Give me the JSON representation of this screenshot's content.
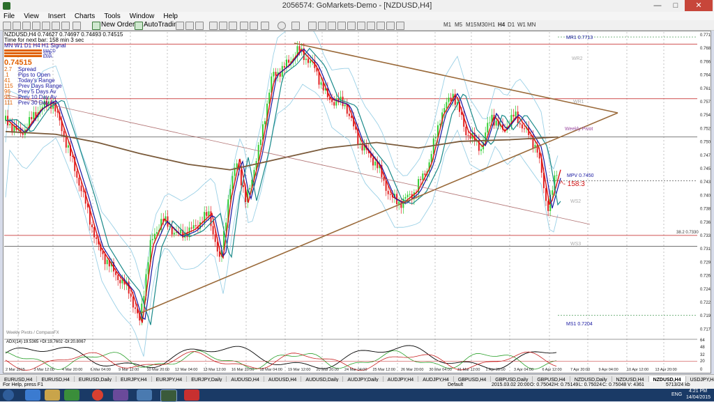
{
  "window": {
    "title": "2056574: GoMarkets-Demo - [NZDUSD,H4]",
    "minimize": "—",
    "maximize": "□",
    "close": "✕"
  },
  "menu": [
    "File",
    "View",
    "Insert",
    "Charts",
    "Tools",
    "Window",
    "Help"
  ],
  "toolbar": {
    "new_order": "New Order",
    "autotrading": "AutoTrading",
    "timeframes": [
      "M1",
      "M5",
      "M15",
      "M30",
      "H1",
      "H4",
      "D1",
      "W1",
      "MN"
    ]
  },
  "chart": {
    "symbol_line": "NZDUSD,H4 0.74627 0.74697 0.74493 0.74515",
    "timer_line": "Time for next bar: 158 min 3 sec",
    "signal_header": "MN W1 D1 H4 H1 Signal",
    "bars_legend": [
      "MACD",
      "STR",
      "EMA"
    ],
    "price": "0.74515",
    "stats": [
      {
        "value": "2.7",
        "label": "Spread"
      },
      {
        "value": ".1",
        "label": "Pips to Open"
      },
      {
        "value": "41",
        "label": "Today's Range"
      },
      {
        "value": "115",
        "label": "Prev Days Range"
      },
      {
        "value": "96",
        "label": "Prev 5 Days Av"
      },
      {
        "value": "95",
        "label": "Prev 10 Day Av"
      },
      {
        "value": "111",
        "label": "Prev 30 Day Av"
      }
    ],
    "pivots": {
      "mr1": "MR1  0.7713",
      "wr2_top": "WR2",
      "wr1": "WR1",
      "wp": "Weekly Pivot",
      "mpv": "MPV  0.7450",
      "pips": "^- 158:3",
      "ws2": "WS2",
      "fib": "38.2  0.7330",
      "ws3": "WS3",
      "ms1": "MS1  0.7204",
      "footer": "Weekly Pivots / CompassFX"
    },
    "price_ticks": [
      "0.77130",
      "0.76895",
      "0.76665",
      "0.76430",
      "0.76195",
      "0.75730",
      "0.75495",
      "0.75230",
      "0.75030",
      "0.74795",
      "0.74515",
      "0.74325",
      "0.74095",
      "0.73860",
      "0.73625",
      "0.73390",
      "0.73160",
      "0.72925",
      "0.72690",
      "0.72460",
      "0.72225",
      "0.71990",
      "0.71755"
    ],
    "time_ticks": [
      "2 Mar 2015",
      "3 Mar 12:00",
      "4 Mar 20:00",
      "6 Mar 04:00",
      "9 Mar 12:00",
      "10 Mar 20:00",
      "12 Mar 04:00",
      "13 Mar 12:00",
      "16 Mar 20:00",
      "18 Mar 04:00",
      "19 Mar 12:00",
      "20 Mar 20:00",
      "24 Mar 04:00",
      "25 Mar 12:00",
      "26 Mar 20:00",
      "30 Mar 04:00",
      "31 Mar 12:00",
      "1 Apr 20:00",
      "3 Apr 04:00",
      "6 Apr 12:00",
      "7 Apr 20:00",
      "9 Apr 04:00",
      "10 Apr 12:00",
      "13 Apr 20:00"
    ],
    "adx_label": "ADX(14) 19.5365 +DI:19.7602 -DI:20.8067",
    "adx_ticks": [
      "64",
      "48",
      "32",
      "20",
      "0"
    ]
  },
  "tabs": [
    "EURUSD,H4",
    "EURUSD,H4",
    "EURUSD,Daily",
    "EURJPY,H4",
    "EURJPY,H4",
    "EURJPY,Daily",
    "AUDUSD,H4",
    "AUDUSD,H4",
    "AUDUSD,Daily",
    "AUDJPY,Daily",
    "AUDJPY,H4",
    "AUDJPY,H4",
    "GBPUSD,H4",
    "GBPUSD,Daily",
    "GBPUSD,H4",
    "NZDUSD,Daily",
    "NZDUSD,H4",
    "NZDUSD,H4",
    "USDJPY,H4",
    "USDJPY,Daily",
    "USDJPY,H4",
    "GBPJPY,H4",
    "GBPJPY,H4",
    "GBPJPY,Daily"
  ],
  "active_tab": 17,
  "status": {
    "help": "For Help, press F1",
    "profile": "Default",
    "time": "2015.03.02 20:00",
    "o": "O: 0.75042",
    "h": "H: 0.75149",
    "l": "L: 0.75024",
    "c": "C: 0.75048",
    "v": "V: 4361",
    "traffic": "5713/24 kb"
  },
  "taskbar": {
    "time": "4:21 PM",
    "date": "14/04/2015",
    "lang": "ENG"
  },
  "colors": {
    "bg": "#ffffff",
    "bull": "#32cd32",
    "bear": "#e02020",
    "red_ma": "#dd1111",
    "blue_ma": "#1616a0",
    "teal_ma": "#1a8a8a",
    "sma200": "#7a5a3a",
    "bands": "#9ad0e6",
    "trend": "#9a6a3a",
    "hline": "#c01818",
    "adx": "#000000",
    "di_plus": "#2aa02a",
    "di_minus": "#c82020"
  }
}
